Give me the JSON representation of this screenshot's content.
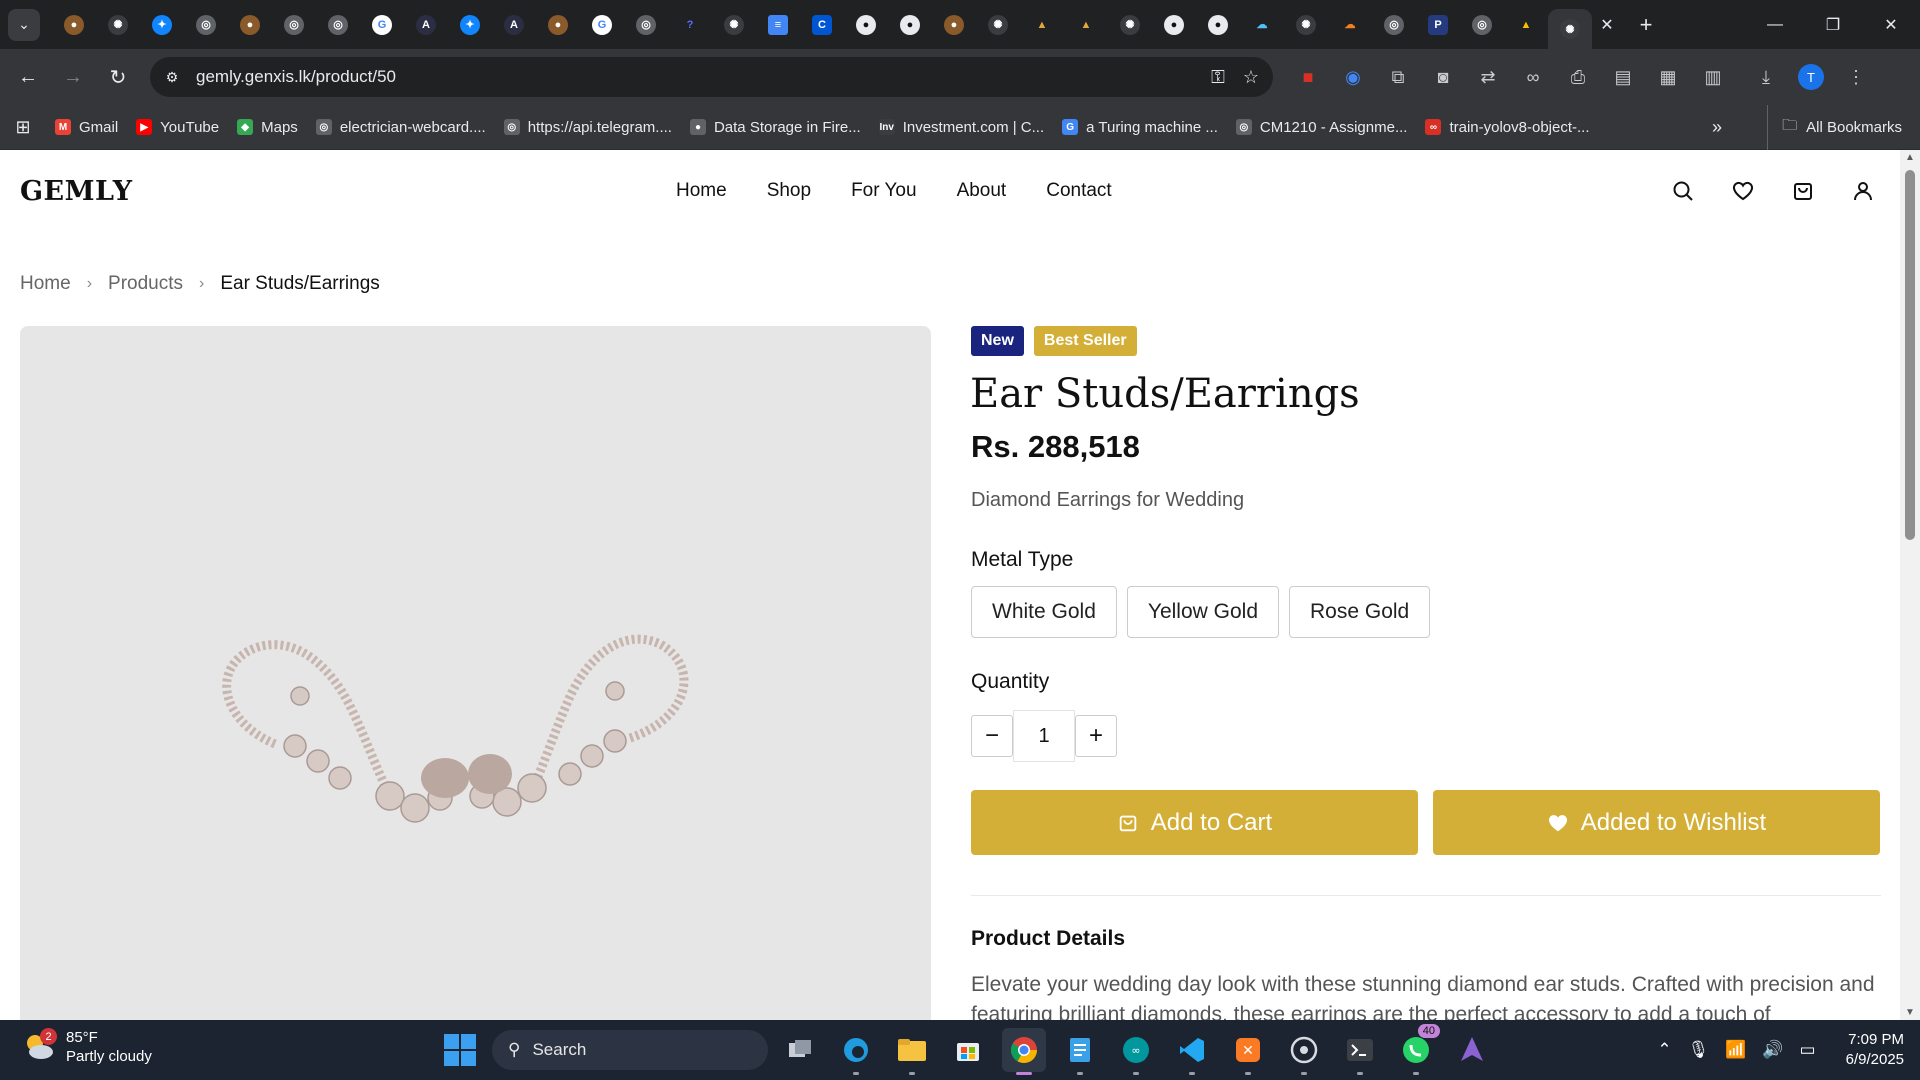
{
  "browser": {
    "url": "gemly.genxis.lk/product/50",
    "bookmarks": [
      {
        "label": "Gmail",
        "icon": "gmail-icon",
        "color": "#ea4335",
        "glyph": "M"
      },
      {
        "label": "YouTube",
        "icon": "youtube-icon",
        "color": "#ff0000",
        "glyph": "▶"
      },
      {
        "label": "Maps",
        "icon": "maps-icon",
        "color": "#34a853",
        "glyph": "◆"
      },
      {
        "label": "electrician-webcard....",
        "icon": "globe-icon",
        "color": "#5f6368",
        "glyph": "◎"
      },
      {
        "label": "https://api.telegram....",
        "icon": "globe-icon",
        "color": "#5f6368",
        "glyph": "◎"
      },
      {
        "label": "Data Storage in Fire...",
        "icon": "github-icon",
        "color": "#5f6368",
        "glyph": "●"
      },
      {
        "label": "Investment.com | C...",
        "icon": "investment-icon",
        "color": "#3a3c3f",
        "glyph": "Inv"
      },
      {
        "label": "a Turing machine ...",
        "icon": "google-icon",
        "color": "#4285f4",
        "glyph": "G"
      },
      {
        "label": "CM1210 - Assignme...",
        "icon": "globe-icon",
        "color": "#5f6368",
        "glyph": "◎"
      },
      {
        "label": "train-yolov8-object-...",
        "icon": "roboflow-icon",
        "color": "#d93025",
        "glyph": "∞"
      }
    ],
    "all_bookmarks_label": "All Bookmarks",
    "profile_initial": "T"
  },
  "site": {
    "logo": "GEMLY",
    "nav": [
      "Home",
      "Shop",
      "For You",
      "About",
      "Contact"
    ]
  },
  "breadcrumb": {
    "home": "Home",
    "products": "Products",
    "current": "Ear Studs/Earrings"
  },
  "product": {
    "badges": [
      {
        "label": "New",
        "color": "#1a237e"
      },
      {
        "label": "Best Seller",
        "color": "#d4af37"
      }
    ],
    "title": "Ear Studs/Earrings",
    "price": "Rs. 288,518",
    "subtitle": "Diamond Earrings for Wedding",
    "metal_label": "Metal Type",
    "metal_options": [
      "White Gold",
      "Yellow Gold",
      "Rose Gold"
    ],
    "quantity_label": "Quantity",
    "quantity": "1",
    "minus": "−",
    "plus": "+",
    "add_to_cart": "Add to Cart",
    "wishlist": "Added to Wishlist",
    "details_title": "Product Details",
    "details_text": "Elevate your wedding day look with these stunning diamond ear studs. Crafted with precision and featuring brilliant diamonds, these earrings are the perfect accessory to add a touch of"
  },
  "taskbar": {
    "weather_temp": "85°F",
    "weather_cond": "Partly cloudy",
    "weather_badge": "2",
    "search_label": "Search",
    "whatsapp_badge": "40",
    "time": "7:09 PM",
    "date": "6/9/2025"
  },
  "colors": {
    "accent_gold": "#d4af37",
    "badge_new": "#1a237e"
  }
}
